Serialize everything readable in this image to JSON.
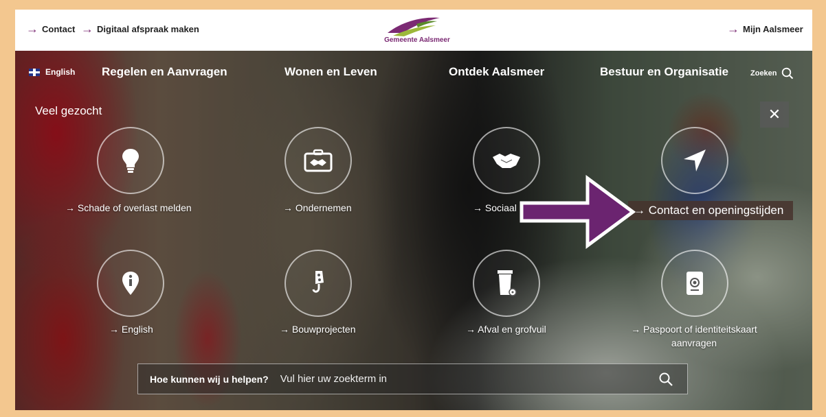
{
  "topbar": {
    "left_links": [
      "Contact",
      "Digitaal afspraak maken"
    ],
    "logo_text": "Gemeente Aalsmeer",
    "right_link": "Mijn Aalsmeer",
    "accent": "#7b2a73"
  },
  "nav": {
    "language": "English",
    "items": [
      "Regelen en Aanvragen",
      "Wonen en Leven",
      "Ontdek Aalsmeer",
      "Bestuur en Organisatie"
    ],
    "search_label": "Zoeken"
  },
  "panel": {
    "title": "Veel gezocht",
    "close_symbol": "✕",
    "tiles": [
      {
        "label": "→ Schade of overlast melden",
        "icon": "lightbulb-icon"
      },
      {
        "label": "→ Ondernemen",
        "icon": "briefcase-handshake-icon"
      },
      {
        "label": "→ Sociaal",
        "icon": "handshake-icon"
      },
      {
        "label": "→ Contact en openingstijden",
        "icon": "location-arrow-icon"
      },
      {
        "label": "→ English",
        "icon": "info-pin-icon"
      },
      {
        "label": "→ Bouwprojecten",
        "icon": "crane-hook-icon"
      },
      {
        "label": "→ Afval en grofvuil",
        "icon": "waste-bin-icon"
      },
      {
        "label": "→ Paspoort of identiteitskaart aanvragen",
        "icon": "passport-icon"
      }
    ]
  },
  "search": {
    "question": "Hoe kunnen wij u helpen?",
    "placeholder": "Vul hier uw zoekterm in"
  },
  "annotation": {
    "arrow_color": "#6b2470"
  }
}
